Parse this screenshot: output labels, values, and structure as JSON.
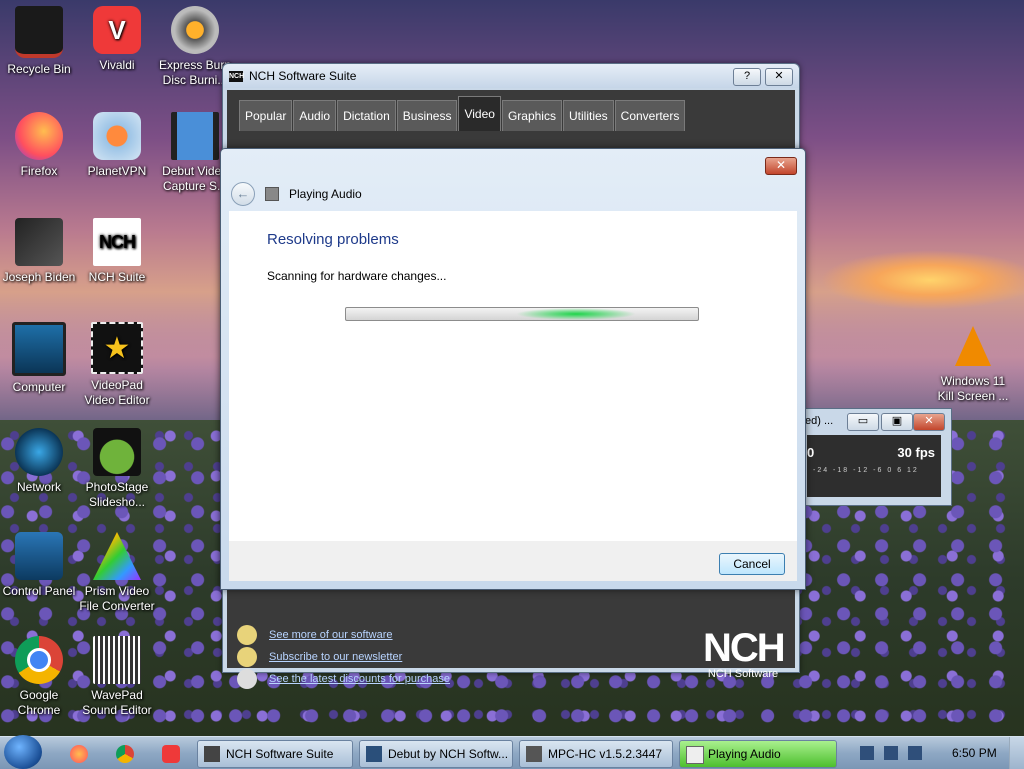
{
  "desktop": {
    "icons": [
      {
        "label": "Recycle Bin",
        "icon": "recycle-bin-icon"
      },
      {
        "label": "Vivaldi",
        "icon": "vivaldi-icon"
      },
      {
        "label": "Express Burn Disc Burni...",
        "icon": "express-burn-icon"
      },
      {
        "label": "Firefox",
        "icon": "firefox-icon"
      },
      {
        "label": "PlanetVPN",
        "icon": "planetvpn-icon"
      },
      {
        "label": "Debut Video Capture S...",
        "icon": "debut-icon"
      },
      {
        "label": "Joseph Biden",
        "icon": "user-folder-icon"
      },
      {
        "label": "NCH Suite",
        "icon": "nch-icon"
      },
      {
        "label": "Computer",
        "icon": "computer-icon"
      },
      {
        "label": "VideoPad Video Editor",
        "icon": "videopad-icon"
      },
      {
        "label": "Network",
        "icon": "network-icon"
      },
      {
        "label": "PhotoStage Slidesho...",
        "icon": "photostage-icon"
      },
      {
        "label": "Control Panel",
        "icon": "control-panel-icon"
      },
      {
        "label": "Prism Video File Converter",
        "icon": "prism-icon"
      },
      {
        "label": "Google Chrome",
        "icon": "chrome-icon"
      },
      {
        "label": "WavePad Sound Editor",
        "icon": "wavepad-icon"
      },
      {
        "label": "Windows 11 Kill Screen ...",
        "icon": "vlc-icon"
      }
    ]
  },
  "nch_window": {
    "title": "NCH Software Suite",
    "help_label": "?",
    "close_label": "✕",
    "tabs": [
      "Popular",
      "Audio",
      "Dictation",
      "Business",
      "Video",
      "Graphics",
      "Utilities",
      "Converters"
    ],
    "active_tab": "Video",
    "links": [
      "See more of our software",
      "Subscribe to our newsletter",
      "See the latest discounts for purchase"
    ],
    "logo_text": "NCH",
    "logo_sub": "NCH Software"
  },
  "recorder_window": {
    "title_fragment": "ed) ...",
    "zero": "0",
    "fps": "30 fps",
    "scale": "-24 -18 -12 -6 0 6 12"
  },
  "dialog": {
    "close_label": "✕",
    "title": "Playing Audio",
    "heading": "Resolving problems",
    "status": "Scanning for hardware changes...",
    "cancel_label": "Cancel"
  },
  "taskbar": {
    "items": [
      {
        "label": "NCH Software Suite",
        "active": false
      },
      {
        "label": "Debut by NCH Softw...",
        "active": false
      },
      {
        "label": "MPC-HC v1.5.2.3447",
        "active": false
      },
      {
        "label": "Playing Audio",
        "active": true
      }
    ],
    "clock": "6:50 PM"
  },
  "colors": {
    "heading": "#1e3a8a",
    "progress_glow": "#1ed44a",
    "active_task": "#4dbf2e"
  }
}
